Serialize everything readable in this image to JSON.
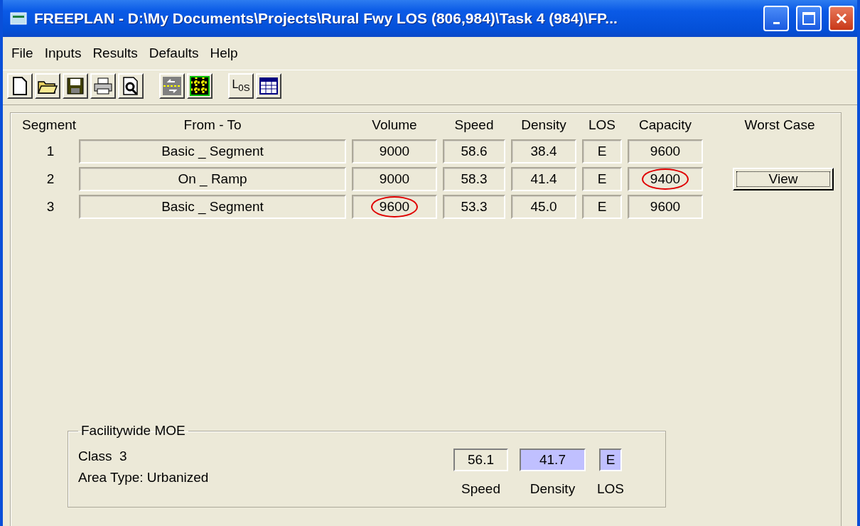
{
  "window": {
    "title": "FREEPLAN - D:\\My Documents\\Projects\\Rural Fwy LOS (806,984)\\Task 4 (984)\\FP..."
  },
  "menu": [
    "File",
    "Inputs",
    "Results",
    "Defaults",
    "Help"
  ],
  "toolbar": [
    [
      {
        "kind": "new"
      },
      {
        "kind": "open"
      },
      {
        "kind": "save"
      },
      {
        "kind": "print"
      },
      {
        "kind": "preview"
      }
    ],
    [
      {
        "kind": "arrows"
      },
      {
        "kind": "grid"
      }
    ],
    [
      {
        "kind": "los",
        "label": "L",
        "sub": "0S"
      },
      {
        "kind": "table"
      }
    ]
  ],
  "table": {
    "columns": [
      "Segment",
      "From - To",
      "Volume",
      "Speed",
      "Density",
      "LOS",
      "Capacity",
      "Worst Case"
    ],
    "rows": [
      {
        "segment": "1",
        "from_to": "Basic _ Segment",
        "volume": {
          "value": "9000",
          "circled": false
        },
        "speed": "58.6",
        "density": "38.4",
        "los": "E",
        "capacity": {
          "value": "9600",
          "circled": false
        }
      },
      {
        "segment": "2",
        "from_to": "On _ Ramp",
        "volume": {
          "value": "9000",
          "circled": false
        },
        "speed": "58.3",
        "density": "41.4",
        "los": "E",
        "capacity": {
          "value": "9400",
          "circled": true
        },
        "worst_case_button": "View"
      },
      {
        "segment": "3",
        "from_to": "Basic _ Segment",
        "volume": {
          "value": "9600",
          "circled": true
        },
        "speed": "53.3",
        "density": "45.0",
        "los": "E",
        "capacity": {
          "value": "9600",
          "circled": false
        }
      }
    ]
  },
  "facilitywide": {
    "title": "Facilitywide MOE",
    "class_label": "Class",
    "class_value": "3",
    "area_type": "Area Type:  Urbanized",
    "measures": [
      {
        "label": "Speed",
        "value": "56.1",
        "highlighted": false
      },
      {
        "label": "Density",
        "value": "41.7",
        "highlighted": true
      },
      {
        "label": "LOS",
        "value": "E",
        "highlighted": true
      }
    ]
  }
}
